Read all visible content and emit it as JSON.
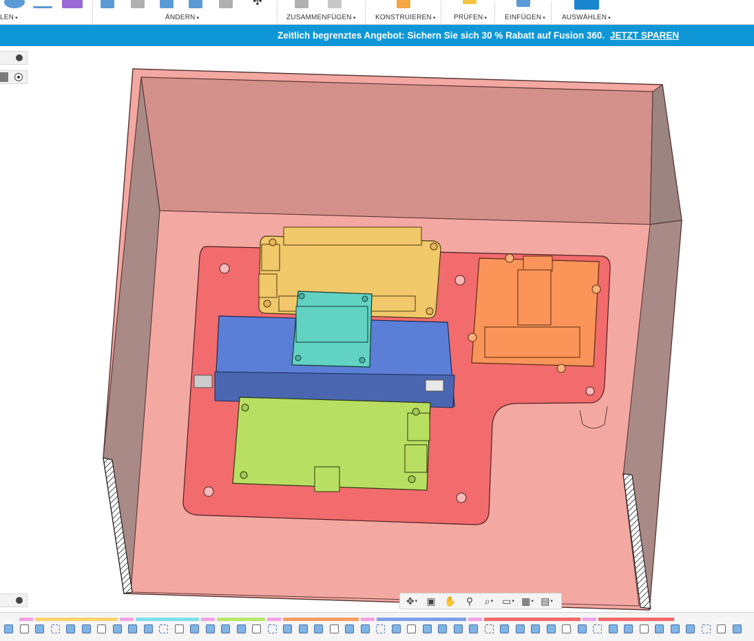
{
  "toolbar": {
    "groups": [
      {
        "label": "LEN",
        "has_caret": true
      },
      {
        "label": "ÄNDERN",
        "has_caret": true
      },
      {
        "label": "ZUSAMMENFÜGEN",
        "has_caret": true
      },
      {
        "label": "KONSTRUIEREN",
        "has_caret": true
      },
      {
        "label": "PRÜFEN",
        "has_caret": true
      },
      {
        "label": "EINFÜGEN",
        "has_caret": true
      },
      {
        "label": "AUSWÄHLEN",
        "has_caret": true
      }
    ],
    "caret": "▾"
  },
  "banner": {
    "text": "Zeitlich begrenztes Angebot: Sichern Sie sich 30 % Rabatt auf Fusion 360.",
    "link": "JETZT SPAREN"
  },
  "colors": {
    "banner_bg": "#0f96d6",
    "enclosure": "#f4a8a2",
    "plate": "#f26b6d",
    "yellow_board": "#f1c86a",
    "teal_board": "#62d2c2",
    "blue_battery": "#5b7fd6",
    "orange_module": "#fa9459",
    "green_board": "#b9df62"
  },
  "navbar": {
    "buttons": [
      {
        "icon": "orbit-icon",
        "glyph": "✥",
        "caret": true
      },
      {
        "icon": "look-at-icon",
        "glyph": "▣",
        "caret": false
      },
      {
        "icon": "pan-icon",
        "glyph": "✋",
        "caret": false
      },
      {
        "icon": "zoom-icon",
        "glyph": "⚲",
        "caret": false
      },
      {
        "icon": "fit-icon",
        "glyph": "⌕",
        "caret": true
      },
      {
        "icon": "display-icon",
        "glyph": "▭",
        "caret": true
      },
      {
        "icon": "grid-icon",
        "glyph": "▦",
        "caret": true
      },
      {
        "icon": "viewports-icon",
        "glyph": "▤",
        "caret": true
      }
    ]
  },
  "timeline": {
    "segment_colors": [
      "#f4a1e6",
      "#f9d36b",
      "#f4a1e6",
      "#7fe0ea",
      "#f4a1e6",
      "#b8e86b",
      "#f4a1e6",
      "#fa9e62",
      "#f4a1e6",
      "#7f9fe8",
      "#f4a1e6",
      "#f46a6a",
      "#f4a1e6",
      "#f46a6a"
    ]
  }
}
